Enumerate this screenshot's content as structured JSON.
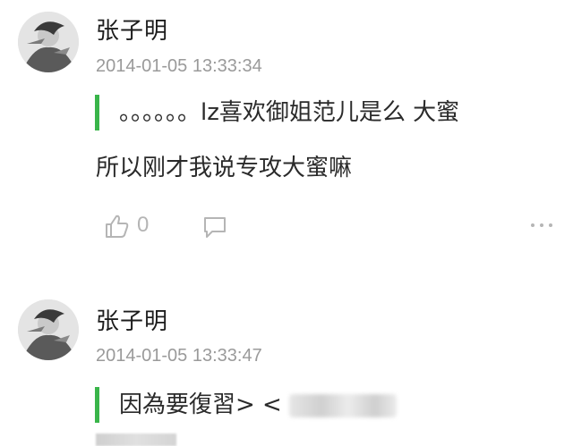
{
  "comments": [
    {
      "username": "张子明",
      "timestamp": "2014-01-05 13:33:34",
      "quote": "。。。。。。lz喜欢御姐范儿是么 大蜜",
      "body": "所以刚才我说专攻大蜜嘛",
      "likes": "0"
    },
    {
      "username": "张子明",
      "timestamp": "2014-01-05 13:33:47",
      "quote": "因為要復習> <"
    }
  ],
  "icons": {
    "like": "thumbs-up-icon",
    "reply": "comment-bubble-icon",
    "more": "more-options-icon"
  },
  "colors": {
    "quote_bar": "#39b54a",
    "timestamp": "#9a9a9a",
    "icon": "#b5b5b5"
  }
}
